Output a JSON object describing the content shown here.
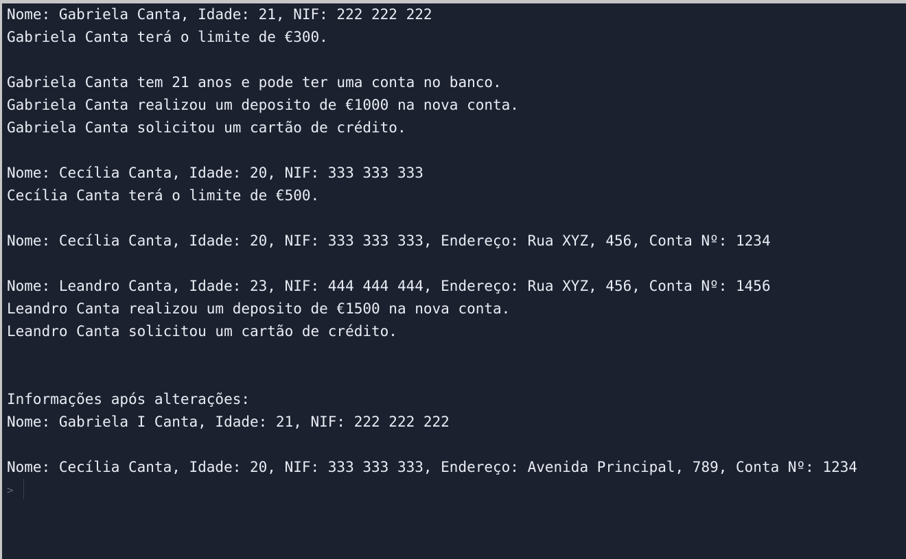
{
  "console": {
    "lines": [
      "Nome: Gabriela Canta, Idade: 21, NIF: 222 222 222",
      "Gabriela Canta terá o limite de €300.",
      "",
      "Gabriela Canta tem 21 anos e pode ter uma conta no banco.",
      "Gabriela Canta realizou um deposito de €1000 na nova conta.",
      "Gabriela Canta solicitou um cartão de crédito.",
      "",
      "Nome: Cecília Canta, Idade: 20, NIF: 333 333 333",
      "Cecília Canta terá o limite de €500.",
      "",
      "Nome: Cecília Canta, Idade: 20, NIF: 333 333 333, Endereço: Rua XYZ, 456, Conta Nº: 1234",
      "",
      "Nome: Leandro Canta, Idade: 23, NIF: 444 444 444, Endereço: Rua XYZ, 456, Conta Nº: 1456",
      "Leandro Canta realizou um deposito de €1500 na nova conta.",
      "Leandro Canta solicitou um cartão de crédito.",
      "",
      "",
      "Informações após alterações:",
      "Nome: Gabriela I Canta, Idade: 21, NIF: 222 222 222",
      "",
      "Nome: Cecília Canta, Idade: 20, NIF: 333 333 333, Endereço: Avenida Principal, 789, Conta Nº: 1234"
    ],
    "prompt": ">"
  },
  "colors": {
    "background": "#1c2130",
    "text": "#e9edf4",
    "prompt": "#5d6578"
  }
}
